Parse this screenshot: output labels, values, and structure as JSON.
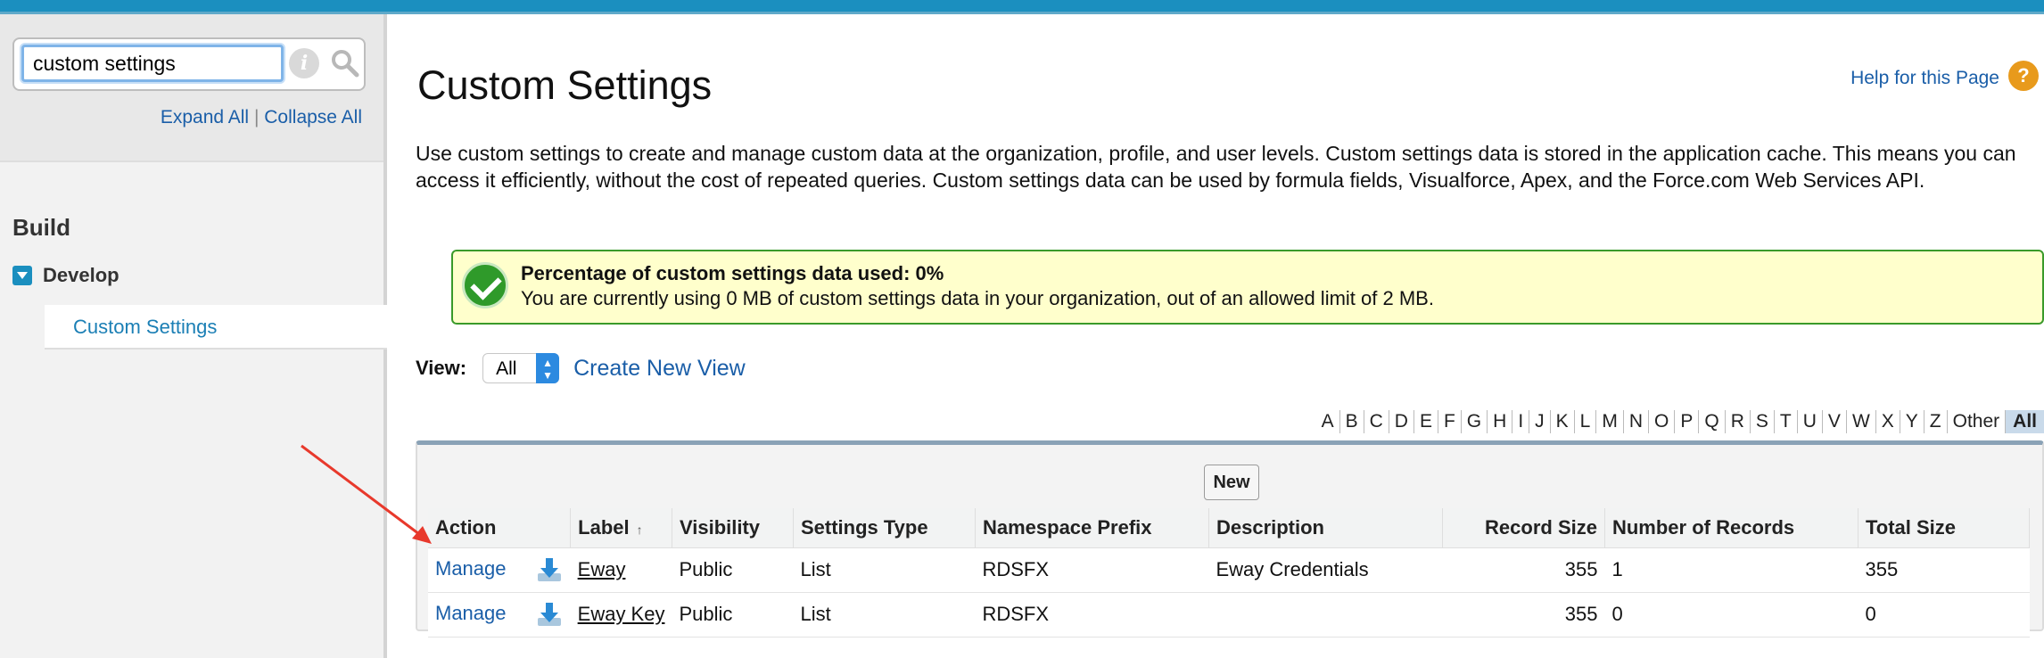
{
  "sidebar": {
    "search_value": "custom settings",
    "expand_all": "Expand All",
    "separator": "|",
    "collapse_all": "Collapse All",
    "build_heading": "Build",
    "develop_label": "Develop",
    "active_item": "Custom Settings"
  },
  "page": {
    "title": "Custom Settings",
    "help_link": "Help for this Page",
    "help_icon": "?",
    "description": "Use custom settings to create and manage custom data at the organization, profile, and user levels. Custom settings data is stored in the application cache. This means you can access it efficiently, without the cost of repeated queries. Custom settings data can be used by formula fields, Visualforce, Apex, and the Force.com Web Services API."
  },
  "notice": {
    "title": "Percentage of custom settings data used: 0%",
    "text": "You are currently using 0 MB of custom settings data in your organization, out of an allowed limit of 2 MB."
  },
  "view": {
    "label": "View:",
    "selected": "All",
    "create_link": "Create New View"
  },
  "alphabet": [
    "A",
    "B",
    "C",
    "D",
    "E",
    "F",
    "G",
    "H",
    "I",
    "J",
    "K",
    "L",
    "M",
    "N",
    "O",
    "P",
    "Q",
    "R",
    "S",
    "T",
    "U",
    "V",
    "W",
    "X",
    "Y",
    "Z",
    "Other",
    "All"
  ],
  "alphabet_active": "All",
  "list": {
    "new_button": "New",
    "columns": {
      "action": "Action",
      "label": "Label",
      "label_sort_indicator": "↑",
      "visibility": "Visibility",
      "settings_type": "Settings Type",
      "namespace_prefix": "Namespace Prefix",
      "description": "Description",
      "record_size": "Record Size",
      "number_of_records": "Number of Records",
      "total_size": "Total Size"
    },
    "rows": [
      {
        "action": "Manage",
        "label": "Eway",
        "visibility": "Public",
        "settings_type": "List",
        "namespace_prefix": "RDSFX",
        "description": "Eway Credentials",
        "record_size": "355",
        "number_of_records": "1",
        "total_size": "355"
      },
      {
        "action": "Manage",
        "label": "Eway Key",
        "visibility": "Public",
        "settings_type": "List",
        "namespace_prefix": "RDSFX",
        "description": "",
        "record_size": "355",
        "number_of_records": "0",
        "total_size": "0"
      }
    ]
  },
  "colors": {
    "brand_bar": "#1b8fbf",
    "link": "#1a5ea8",
    "annotation_arrow": "#e8392c",
    "notice_bg": "#ffffcc",
    "notice_border": "#3a9a2a"
  }
}
